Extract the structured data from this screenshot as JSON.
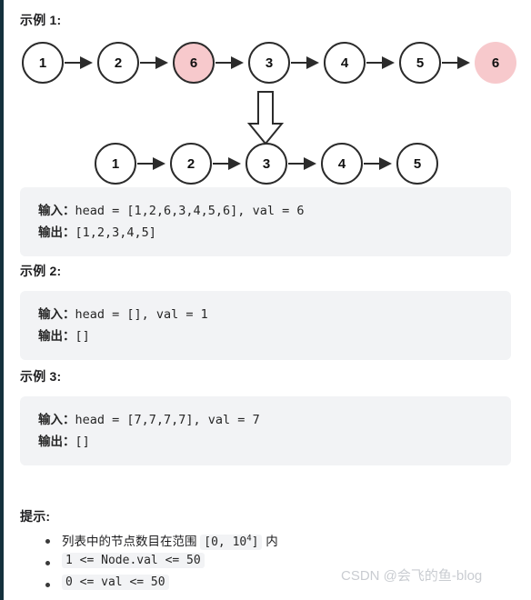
{
  "accent": {
    "left_rail": "#14303c",
    "code_bg": "#f2f3f5",
    "node_stroke": "#2b2b2b",
    "node_highlight_fill": "#f7c9cc",
    "watermark_color": "#c9ccd1"
  },
  "sections": [
    {
      "heading": "示例 1:"
    },
    {
      "heading": "示例 2:"
    },
    {
      "heading": "示例 3:"
    },
    {
      "heading": "提示:"
    }
  ],
  "diagram": {
    "before": {
      "values": [
        "1",
        "2",
        "6",
        "3",
        "4",
        "5",
        "6"
      ],
      "highlighted": [
        false,
        false,
        true,
        false,
        false,
        false,
        true
      ]
    },
    "transform_arrow": "down-arrow",
    "after": {
      "values": [
        "1",
        "2",
        "3",
        "4",
        "5"
      ],
      "highlighted": [
        false,
        false,
        false,
        false,
        false
      ]
    }
  },
  "examples": [
    {
      "input_label": "输入：",
      "input_value": "head = [1,2,6,3,4,5,6], val = 6",
      "output_label": "输出：",
      "output_value": "[1,2,3,4,5]"
    },
    {
      "input_label": "输入：",
      "input_value": "head = [], val = 1",
      "output_label": "输出：",
      "output_value": "[]"
    },
    {
      "input_label": "输入：",
      "input_value": "head = [7,7,7,7], val = 7",
      "output_label": "输出：",
      "output_value": "[]"
    }
  ],
  "hints": [
    {
      "prefix": "列表中的节点数目在范围 ",
      "code_pre": "[0, 10",
      "code_sup": "4",
      "code_post": "]",
      "suffix": " 内"
    },
    {
      "prefix": "",
      "code_pre": "1 <= Node.val <= 50",
      "code_sup": "",
      "code_post": "",
      "suffix": ""
    },
    {
      "prefix": "",
      "code_pre": "0 <= val <= 50",
      "code_sup": "",
      "code_post": "",
      "suffix": ""
    }
  ],
  "watermark": {
    "text": "CSDN @会飞的鱼-blog"
  }
}
